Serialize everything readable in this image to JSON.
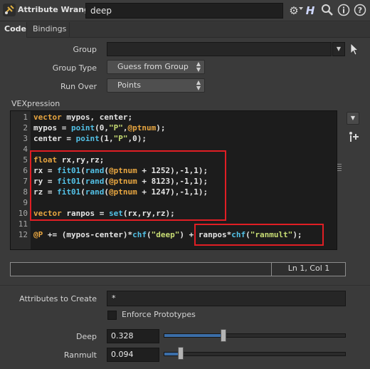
{
  "header": {
    "node_type": "Attribute Wrangle",
    "node_name": "deep",
    "icons": [
      "gear-icon",
      "help-h-icon",
      "search-icon",
      "info-icon",
      "help-icon"
    ]
  },
  "tabs": [
    {
      "label": "Code",
      "active": true
    },
    {
      "label": "Bindings",
      "active": false
    }
  ],
  "params": {
    "group_label": "Group",
    "group_value": "",
    "group_type_label": "Group Type",
    "group_type_value": "Guess from Group",
    "run_over_label": "Run Over",
    "run_over_value": "Points"
  },
  "vexpression": {
    "label": "VEXpression",
    "line_numbers": [
      "1",
      "2",
      "3",
      "4",
      "5",
      "6",
      "7",
      "8",
      "9",
      "10",
      "11",
      "12"
    ],
    "lines": [
      "vector mypos, center;",
      "mypos = point(0,\"P\",@ptnum);",
      "center = point(1,\"P\",0);",
      "",
      "float rx,ry,rz;",
      "rx = fit01(rand(@ptnum + 1252),-1,1);",
      "ry = fit01(rand(@ptnum + 8123),-1,1);",
      "rz = fit01(rand(@ptnum + 1247),-1,1);",
      "",
      "vector ranpos = set(rx,ry,rz);",
      "",
      "@P += (mypos-center)*chf(\"deep\") + ranpos*chf(\"ranmult\");"
    ],
    "status": "",
    "cursor": "Ln 1, Col 1"
  },
  "attributes": {
    "create_label": "Attributes to Create",
    "create_value": "*",
    "enforce_label": "Enforce Prototypes",
    "enforce_checked": false
  },
  "sliders": {
    "deep_label": "Deep",
    "deep_value": "0.328",
    "deep_fraction": 0.328,
    "ranmult_label": "Ranmult",
    "ranmult_value": "0.094",
    "ranmult_fraction": 0.094
  },
  "colors": {
    "highlight": "#e01e24",
    "keyword": "#e8a640",
    "function": "#53c1e6",
    "string": "#c8dd74",
    "slider_fill": "#3b6ea8"
  }
}
